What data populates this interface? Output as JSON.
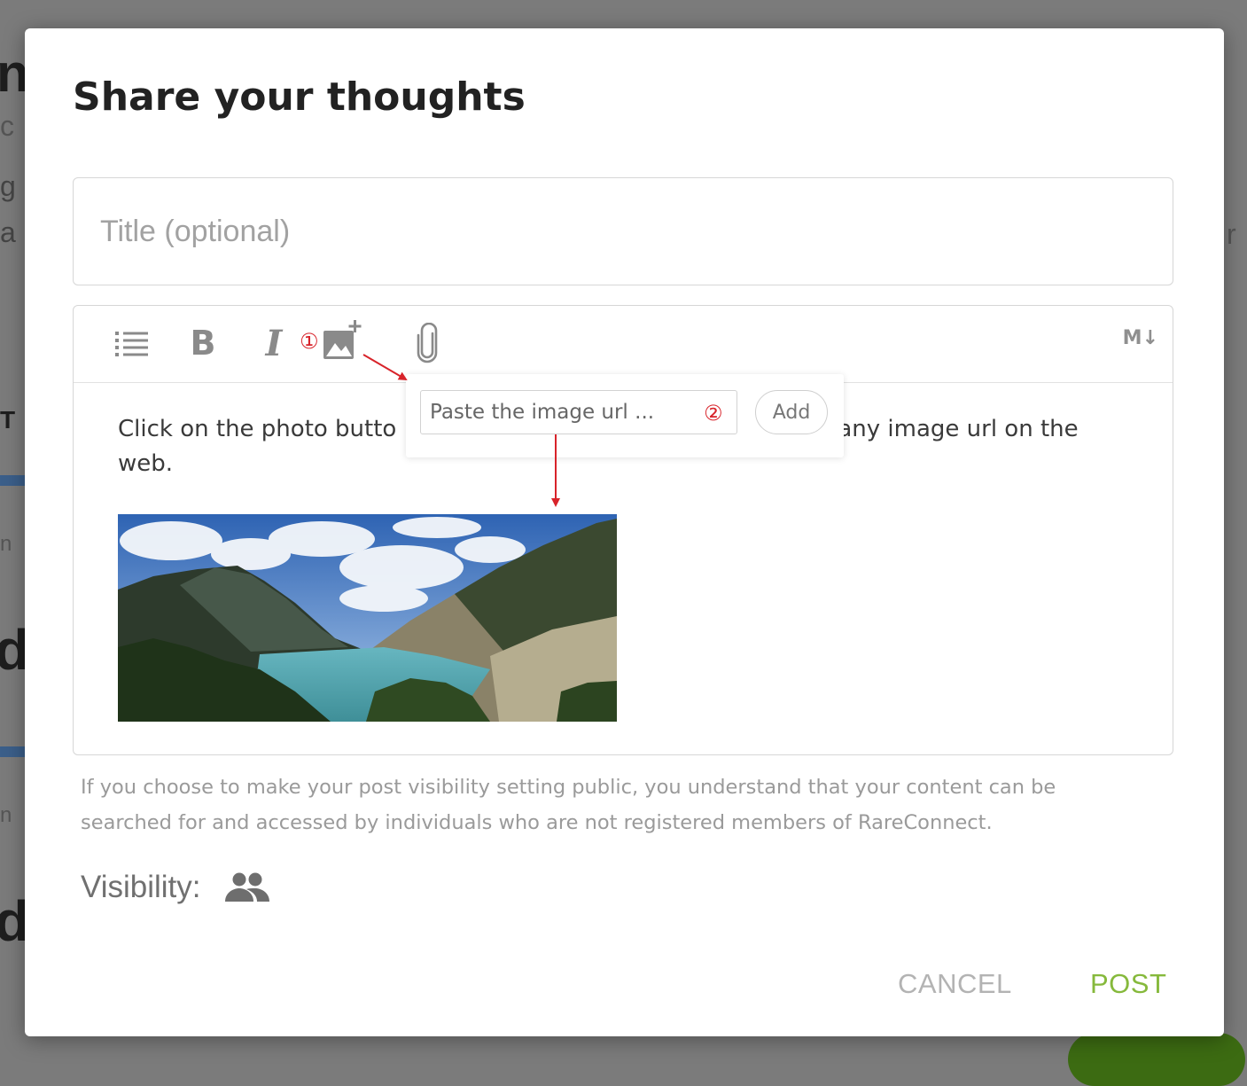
{
  "modal": {
    "title": "Share your thoughts",
    "title_placeholder": "Title (optional)"
  },
  "toolbar": {
    "items": [
      "list-icon",
      "bold-icon",
      "italic-icon",
      "add-image-icon",
      "paperclip-icon"
    ],
    "bold_label": "B",
    "italic_label": "I",
    "markdown_label": "M↓"
  },
  "editor": {
    "text_before": "Click on the photo butto",
    "text_after": "any image url on the web."
  },
  "url_popover": {
    "placeholder": "Paste the image url ...",
    "add_label": "Add"
  },
  "annotations": {
    "step1": "①",
    "step2": "②",
    "color": "#d8232a"
  },
  "disclaimer": "If you choose to make your post visibility setting public, you understand that your content can be searched for and accessed by individuals who are not registered members of RareConnect.",
  "visibility": {
    "label": "Visibility:",
    "icon": "people-icon"
  },
  "actions": {
    "cancel": "CANCEL",
    "post": "POST"
  },
  "colors": {
    "post": "#86b93c",
    "cancel": "#b3b3b3",
    "overlay": "#7b7b7b"
  }
}
